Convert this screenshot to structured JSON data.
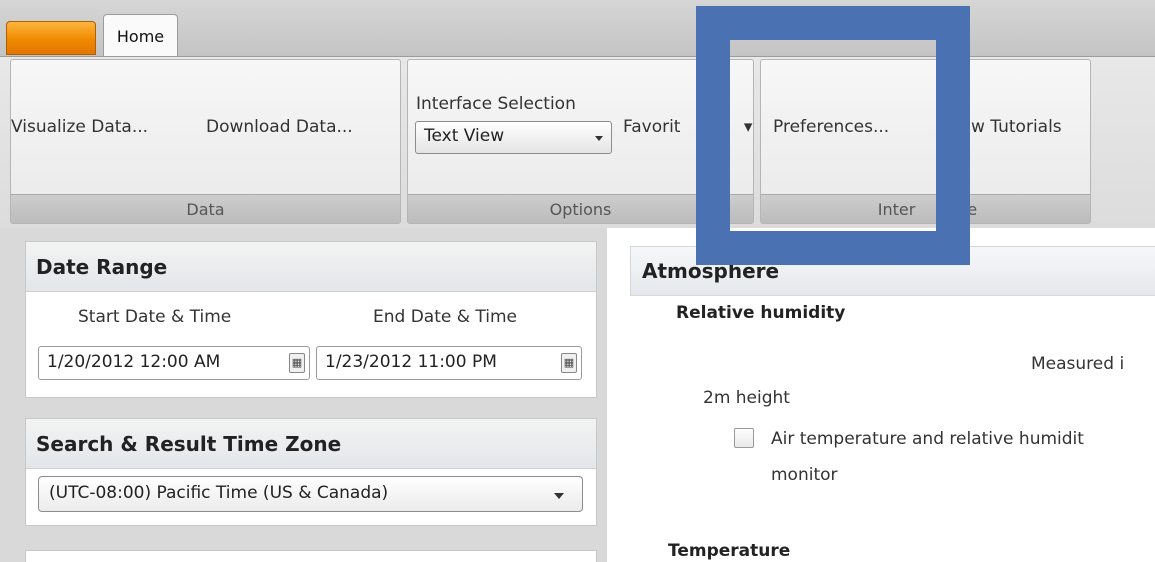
{
  "ribbon": {
    "tabs": [
      {
        "label": "Home",
        "active": true
      }
    ],
    "groups": {
      "data": {
        "label": "Data",
        "buttons": [
          "Visualize Data...",
          "Download Data..."
        ]
      },
      "options": {
        "label": "Options",
        "interface_selection_label": "Interface Selection",
        "interface_selection_value": "Text View",
        "favorites_label": "Favorit",
        "favorites_arrow": "▾"
      },
      "interface": {
        "label_left": "Inter",
        "label_right": "e",
        "preferences_label": "Preferences...",
        "tutorials_label": "w Tutorials"
      }
    },
    "highlight_color": "#4a72b3",
    "app_button_color": "#f28c00"
  },
  "date_range": {
    "title": "Date Range",
    "start_label": "Start Date & Time",
    "end_label": "End Date & Time",
    "start_value": "1/20/2012 12:00 AM",
    "end_value": "1/23/2012 11:00 PM",
    "calendar_glyph": "▦"
  },
  "time_zone": {
    "title": "Search & Result Time Zone",
    "selected": "(UTC-08:00) Pacific Time (US & Canada)"
  },
  "atmosphere": {
    "title": "Atmosphere",
    "relative_humidity": "Relative humidity",
    "measured_in": "Measured i",
    "height": "2m height",
    "sensor_line1": "Air temperature and relative humidit",
    "sensor_line2": "monitor",
    "sensor_checked": false,
    "temperature": "Temperature"
  }
}
